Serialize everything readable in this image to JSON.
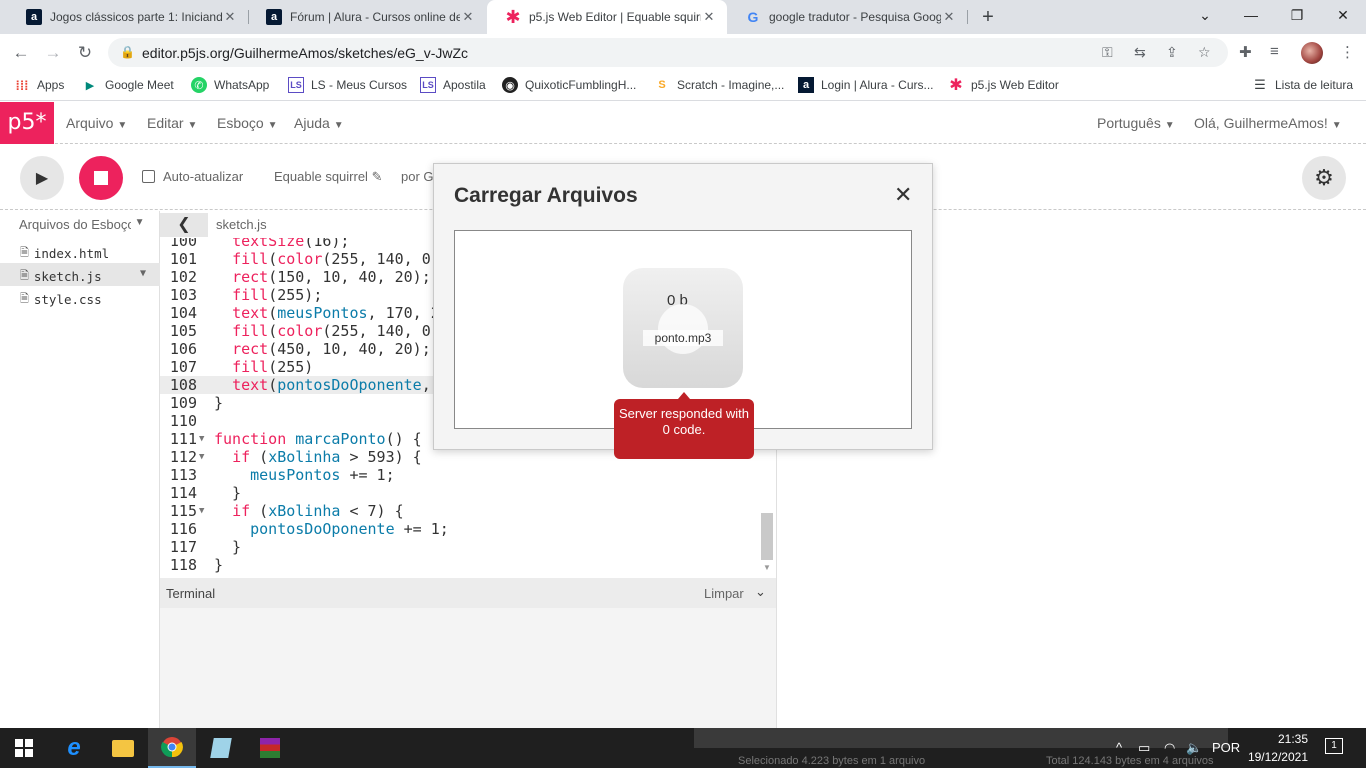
{
  "browser": {
    "tabs": [
      {
        "title": "Jogos clássicos parte 1: Iniciando",
        "favicon": "alura-icon",
        "active": false
      },
      {
        "title": "Fórum | Alura - Cursos online de",
        "favicon": "alura-icon",
        "active": false
      },
      {
        "title": "p5.js Web Editor | Equable squirre",
        "favicon": "p5-icon",
        "active": true
      },
      {
        "title": "google tradutor - Pesquisa Goog",
        "favicon": "google-icon",
        "active": false
      }
    ],
    "url": "editor.p5js.org/GuilhermeAmos/sketches/eG_v-JwZc",
    "bookmarks": [
      {
        "label": "Apps",
        "icon": "apps-grid-icon"
      },
      {
        "label": "Google Meet",
        "icon": "google-meet-icon"
      },
      {
        "label": "WhatsApp",
        "icon": "whatsapp-icon"
      },
      {
        "label": "LS - Meus Cursos",
        "icon": "ls-icon"
      },
      {
        "label": "Apostila",
        "icon": "ls-icon"
      },
      {
        "label": "QuixoticFumblingH...",
        "icon": "replit-icon"
      },
      {
        "label": "Scratch - Imagine,...",
        "icon": "scratch-icon"
      },
      {
        "label": "Login | Alura - Curs...",
        "icon": "alura-icon"
      },
      {
        "label": "p5.js Web Editor",
        "icon": "p5-icon"
      }
    ],
    "reading_list": "Lista de leitura"
  },
  "p5": {
    "logo": "p5*",
    "menus": [
      "Arquivo",
      "Editar",
      "Esboço",
      "Ajuda"
    ],
    "language": "Português",
    "greeting": "Olá, GuilhermeAmos!",
    "auto_refresh": "Auto-atualizar",
    "sketch_name": "Equable squirrel",
    "by_label": "por G",
    "files_header": "Arquivos do Esboço",
    "files": [
      "index.html",
      "sketch.js",
      "style.css"
    ],
    "selected_file": "sketch.js",
    "open_file": "sketch.js",
    "terminal_label": "Terminal",
    "clear_label": "Limpar"
  },
  "code_lines": [
    {
      "n": "100",
      "t": "  textSize(16);"
    },
    {
      "n": "101",
      "t": "  fill(color(255, 140, 0"
    },
    {
      "n": "102",
      "t": "  rect(150, 10, 40, 20);"
    },
    {
      "n": "103",
      "t": "  fill(255);"
    },
    {
      "n": "104",
      "t": "  text(meusPontos, 170, 2"
    },
    {
      "n": "105",
      "t": "  fill(color(255, 140, 0"
    },
    {
      "n": "106",
      "t": "  rect(450, 10, 40, 20);"
    },
    {
      "n": "107",
      "t": "  fill(255)"
    },
    {
      "n": "108",
      "t": "  text(pontosDoOponente,"
    },
    {
      "n": "109",
      "t": "}"
    },
    {
      "n": "110",
      "t": ""
    },
    {
      "n": "111",
      "t": "function marcaPonto() {"
    },
    {
      "n": "112",
      "t": "  if (xBolinha > 593) {"
    },
    {
      "n": "113",
      "t": "    meusPontos += 1;"
    },
    {
      "n": "114",
      "t": "  }"
    },
    {
      "n": "115",
      "t": "  if (xBolinha < 7) {"
    },
    {
      "n": "116",
      "t": "    pontosDoOponente += 1;"
    },
    {
      "n": "117",
      "t": "  }"
    },
    {
      "n": "118",
      "t": "}"
    }
  ],
  "modal": {
    "title": "Carregar Arquivos",
    "file_size": "0 b",
    "file_name": "ponto.mp3",
    "error": "Server responded with 0 code."
  },
  "taskbar": {
    "language": "POR",
    "time": "21:35",
    "date": "19/12/2021",
    "ghost_selected": "Selecionado 4.223 bytes em 1 arquivo",
    "ghost_total": "Total 124.143 bytes em 4 arquivos",
    "notification_count": "1"
  },
  "colors": {
    "p5_pink": "#ed225d",
    "error_red": "#be2126"
  }
}
